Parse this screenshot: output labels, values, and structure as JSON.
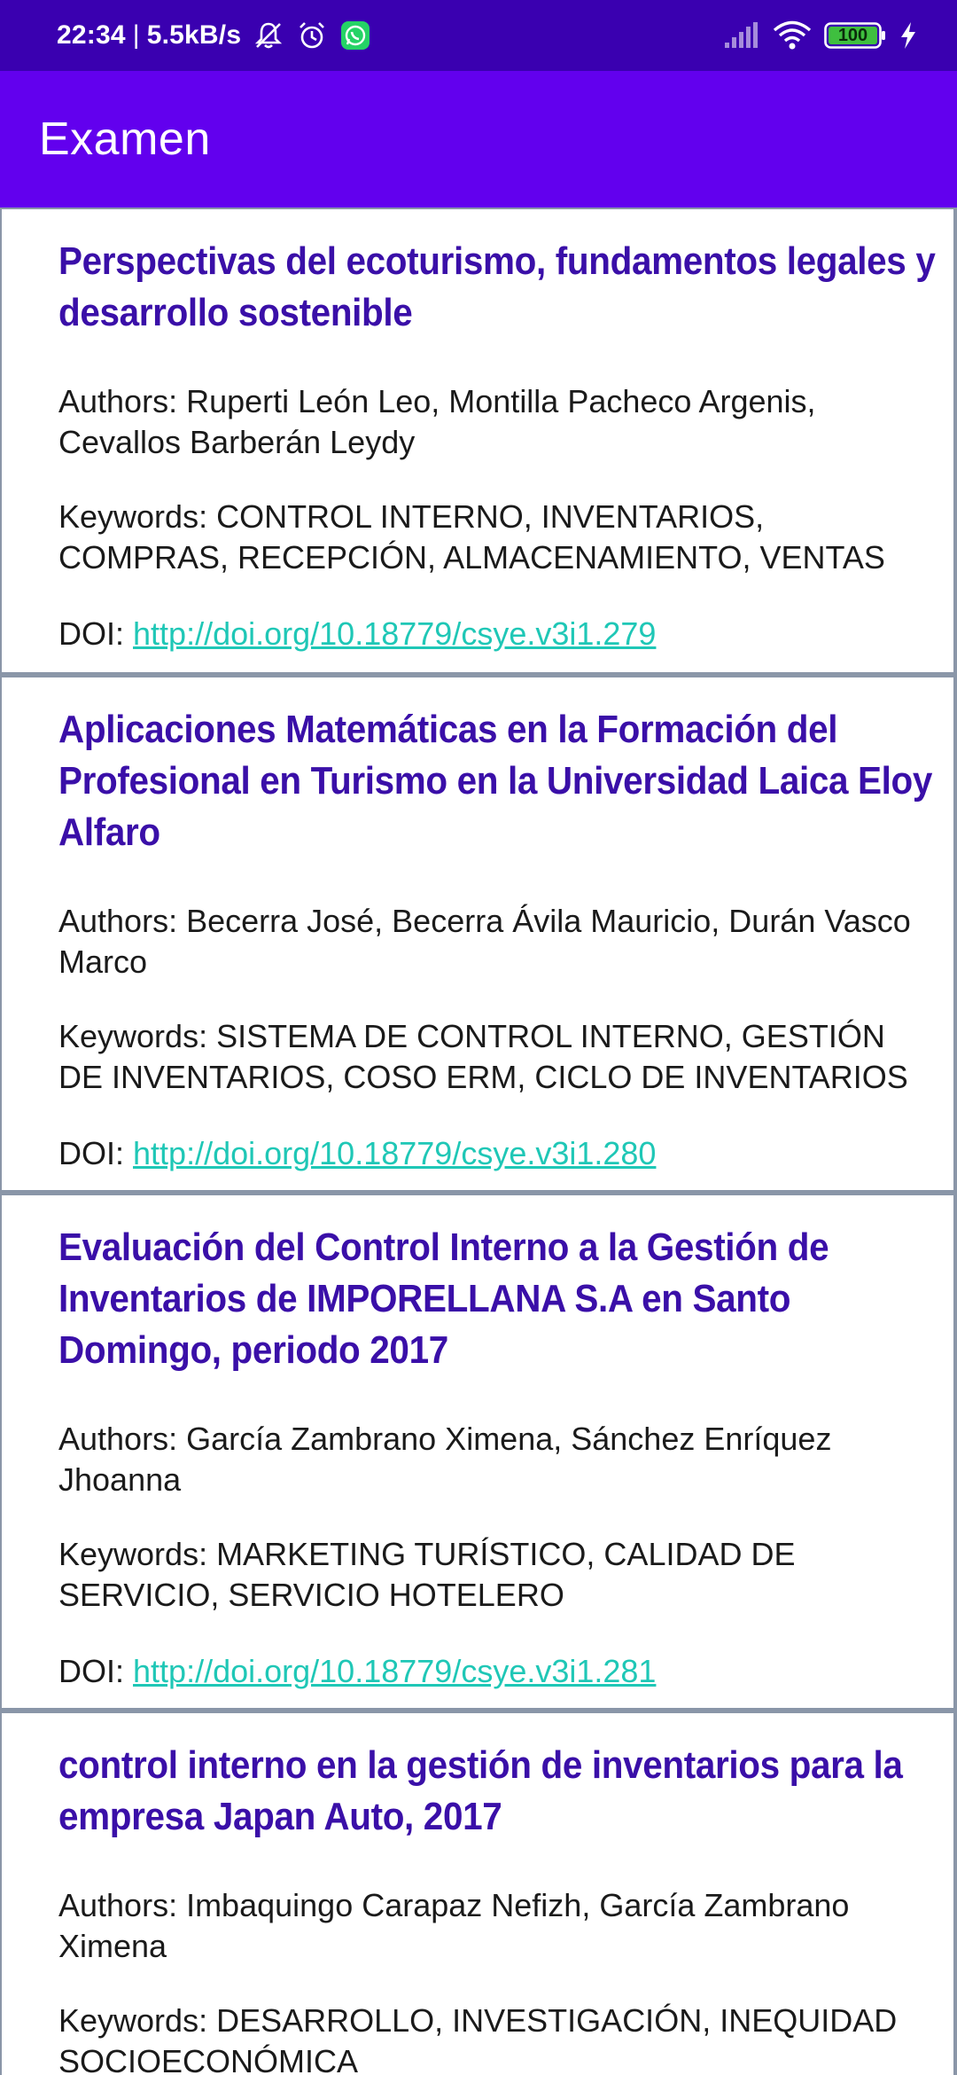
{
  "status_bar": {
    "time": "22:34",
    "separator": "|",
    "speed": "5.5kB/s",
    "battery": "100",
    "icons": [
      "mute-icon",
      "alarm-icon",
      "whatsapp-icon",
      "signal-icon",
      "wifi-icon",
      "battery-icon",
      "charging-icon"
    ]
  },
  "app_bar": {
    "title": "Examen"
  },
  "colors": {
    "status_bar": "#3a00b0",
    "app_bar": "#6200ee",
    "title_text": "#3a0fa8",
    "link": "#1fc7b6",
    "divider": "#8a96a8"
  },
  "articles": [
    {
      "title": "Perspectivas del ecoturismo, fundamentos legales y desarrollo sostenible",
      "authors": "Authors: Ruperti León Leo, Montilla Pacheco Argenis, Cevallos Barberán Leydy",
      "keywords": "Keywords: CONTROL INTERNO, INVENTARIOS, COMPRAS, RECEPCIÓN, ALMACENAMIENTO, VENTAS",
      "doi_label": "DOI:",
      "doi_url": "http://doi.org/10.18779/csye.v3i1.279"
    },
    {
      "title": "Aplicaciones Matemáticas en la Formación del Profesional en Turismo en la Universidad Laica Eloy Alfaro",
      "authors": "Authors: Becerra José, Becerra Ávila Mauricio, Durán Vasco Marco",
      "keywords": "Keywords: SISTEMA DE CONTROL INTERNO, GESTIÓN DE INVENTARIOS, COSO ERM, CICLO DE INVENTARIOS",
      "doi_label": "DOI:",
      "doi_url": "http://doi.org/10.18779/csye.v3i1.280"
    },
    {
      "title": "Evaluación del Control Interno a la Gestión de Inventarios de IMPORELLANA S.A en Santo Domingo, periodo 2017",
      "authors": "Authors: García Zambrano Ximena, Sánchez Enríquez Jhoanna",
      "keywords": "Keywords: MARKETING TURÍSTICO, CALIDAD DE SERVICIO, SERVICIO HOTELERO",
      "doi_label": "DOI:",
      "doi_url": "http://doi.org/10.18779/csye.v3i1.281"
    },
    {
      "title": "control interno en la gestión de inventarios para la empresa Japan Auto, 2017",
      "authors": "Authors: Imbaquingo Carapaz Nefizh, García Zambrano Ximena",
      "keywords": "Keywords: DESARROLLO, INVESTIGACIÓN, INEQUIDAD SOCIOECONÓMICA"
    }
  ]
}
